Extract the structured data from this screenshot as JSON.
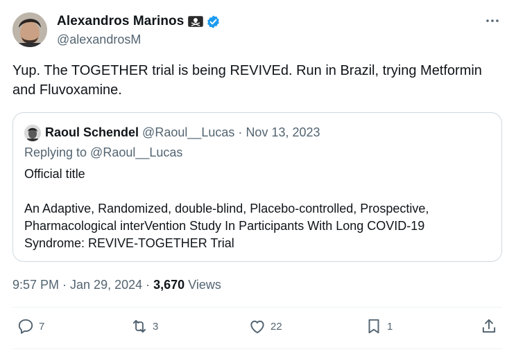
{
  "author": {
    "name": "Alexandros Marinos",
    "handle": "@alexandrosM"
  },
  "tweet": {
    "text": "Yup. The TOGETHER trial is being REVIVEd. Run in Brazil, trying Metformin and Fluvoxamine."
  },
  "quoted": {
    "name": "Raoul Schendel",
    "handle": "@Raoul__Lucas",
    "separator": "·",
    "date": "Nov 13, 2023",
    "replying_to": "Replying to @Raoul__Lucas",
    "line1": "Official title",
    "line2": "An Adaptive, Randomized, double-blind, Placebo-controlled, Prospective,",
    "line3": "Pharmacological interVention Study In Participants With Long COVID-19",
    "line4": "Syndrome: REVIVE-TOGETHER Trial"
  },
  "meta": {
    "time": "9:57 PM · Jan 29, 2024 ·",
    "views_count": "3,670",
    "views_label": "Views"
  },
  "actions": {
    "replies": "7",
    "retweets": "3",
    "likes": "22",
    "bookmarks": "1"
  },
  "icons": [
    "pirate-flag-icon",
    "verified-badge-icon",
    "more-icon",
    "reply-icon",
    "retweet-icon",
    "like-icon",
    "bookmark-icon",
    "share-icon"
  ],
  "colors": {
    "verified": "#1d9bf0",
    "secondary_text": "#536471",
    "border": "#cfd9de"
  }
}
